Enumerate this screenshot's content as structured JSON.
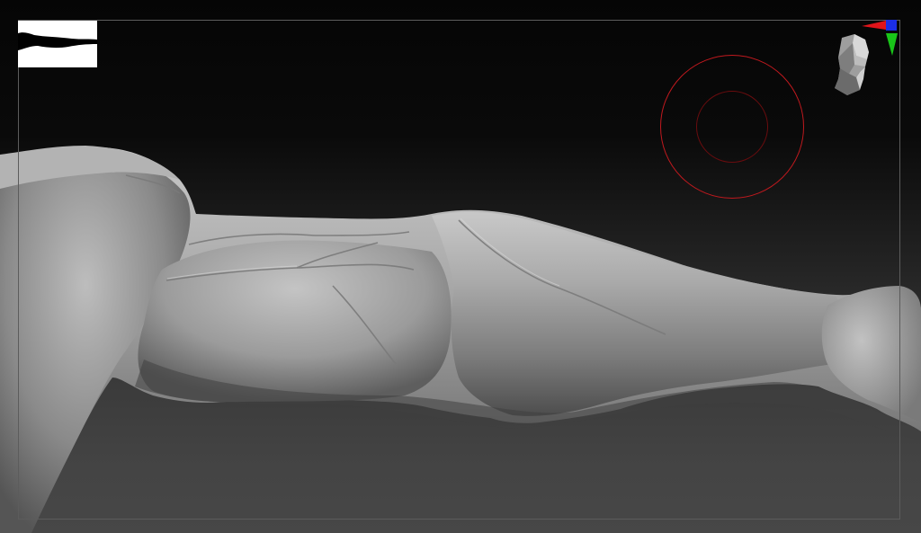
{
  "app": {
    "document_title": ""
  },
  "canvas": {
    "background_top": "#050505",
    "background_bottom": "#474747",
    "model_color": "#9a9a9a"
  },
  "brush": {
    "outer_color": "#c0191e",
    "inner_color": "#6a0c0e"
  },
  "navigator": {
    "icon": "navigator-thumbnail"
  },
  "gizmo": {
    "x_axis_color": "#e0141a",
    "y_axis_color": "#19c519",
    "z_axis_color": "#1b2ee6",
    "head_icon": "orientation-head-icon"
  }
}
